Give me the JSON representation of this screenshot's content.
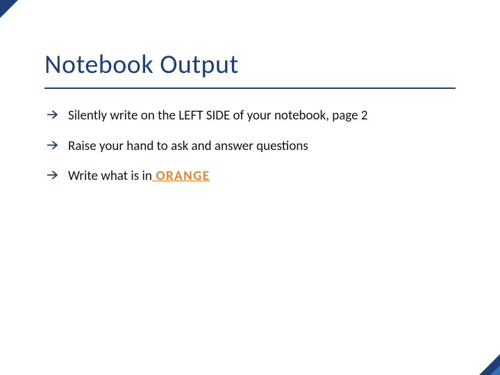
{
  "colors": {
    "accent_navy": "#1f3f77",
    "accent_navy_light": "#3b6fb3",
    "accent_orange": "#e7832b"
  },
  "title": "Notebook Output",
  "bullets": [
    {
      "text": "Silently write on the LEFT SIDE of your notebook, page 2"
    },
    {
      "text": "Raise your hand to ask and answer questions"
    },
    {
      "prefix": "Write what is in",
      "emph": " ORANGE"
    }
  ]
}
